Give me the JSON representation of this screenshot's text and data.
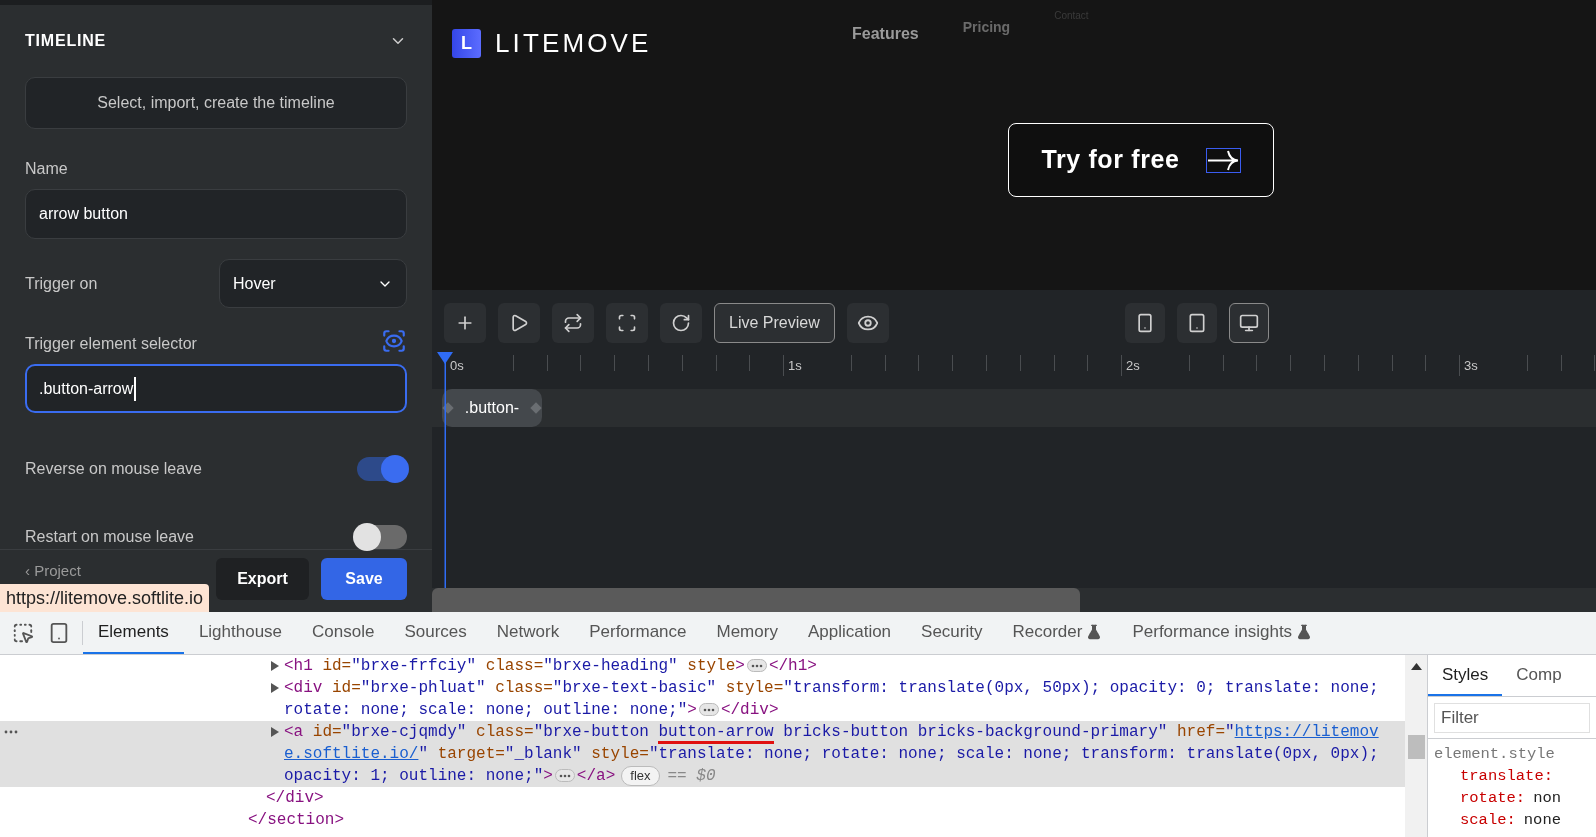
{
  "panel": {
    "title": "TIMELINE",
    "select_button": "Select, import, create the timeline",
    "name_label": "Name",
    "name_value": "arrow button",
    "trigger_label": "Trigger on",
    "trigger_value": "Hover",
    "selector_label": "Trigger element selector",
    "selector_value": ".button-arrow",
    "toggles": [
      {
        "label": "Reverse on mouse leave",
        "on": true
      },
      {
        "label": "Restart on mouse leave",
        "on": false
      }
    ],
    "back_link": "‹ Project",
    "export": "Export",
    "save": "Save"
  },
  "link_tooltip": "https://litemove.softlite.io",
  "preview": {
    "logo_letter": "L",
    "brand": "LITEMOVE",
    "nav": [
      {
        "label": "Features",
        "kind": "main"
      },
      {
        "label": "Pricing",
        "kind": "faded"
      },
      {
        "label": "Contact",
        "kind": "ghost"
      }
    ],
    "cta": "Try for free"
  },
  "timeline": {
    "live_preview": "Live Preview",
    "devices": [
      {
        "selected": false
      },
      {
        "selected": false
      },
      {
        "selected": true
      }
    ],
    "ruler": [
      "0s",
      "1s",
      "2s",
      "3s"
    ],
    "tracks": [
      {
        "label": ".button-"
      }
    ]
  },
  "devtools": {
    "tabs": [
      {
        "label": "Elements",
        "selected": true,
        "experimental": false
      },
      {
        "label": "Lighthouse",
        "selected": false,
        "experimental": false
      },
      {
        "label": "Console",
        "selected": false,
        "experimental": false
      },
      {
        "label": "Sources",
        "selected": false,
        "experimental": false
      },
      {
        "label": "Network",
        "selected": false,
        "experimental": false
      },
      {
        "label": "Performance",
        "selected": false,
        "experimental": false
      },
      {
        "label": "Memory",
        "selected": false,
        "experimental": false
      },
      {
        "label": "Application",
        "selected": false,
        "experimental": false
      },
      {
        "label": "Security",
        "selected": false,
        "experimental": false
      },
      {
        "label": "Recorder",
        "selected": false,
        "experimental": true
      },
      {
        "label": "Performance insights",
        "selected": false,
        "experimental": true
      }
    ],
    "dom": {
      "children": [
        {
          "children": [
            {
              "selected": false,
              "lines": [
                [
                  {
                    "kind": "tag",
                    "text": "<h1"
                  },
                  {
                    "kind": "attr",
                    "text": " id="
                  },
                  {
                    "kind": "value",
                    "text": "\"brxe-frfciy\""
                  },
                  {
                    "kind": "attr",
                    "text": " class="
                  },
                  {
                    "kind": "value",
                    "text": "\"brxe-heading\""
                  },
                  {
                    "kind": "attr",
                    "text": " style"
                  },
                  {
                    "kind": "tag",
                    "text": ">"
                  },
                  {
                    "kind": "dots"
                  },
                  {
                    "kind": "tag",
                    "text": "</h1>"
                  }
                ]
              ]
            },
            {
              "selected": false,
              "lines": [
                [
                  {
                    "kind": "tag",
                    "text": "<div"
                  },
                  {
                    "kind": "attr",
                    "text": " id="
                  },
                  {
                    "kind": "value",
                    "text": "\"brxe-phluat\""
                  },
                  {
                    "kind": "attr",
                    "text": " class="
                  },
                  {
                    "kind": "value",
                    "text": "\"brxe-text-basic\""
                  },
                  {
                    "kind": "attr",
                    "text": " style="
                  },
                  {
                    "kind": "value",
                    "text": "\"transform: translate(0px, 50px); opacity: 0; translate: none;"
                  }
                ],
                [
                  {
                    "kind": "value",
                    "text": "rotate: none; scale: none; outline: none;\""
                  },
                  {
                    "kind": "tag",
                    "text": ">"
                  },
                  {
                    "kind": "dots"
                  },
                  {
                    "kind": "tag",
                    "text": "</div>"
                  }
                ]
              ]
            },
            {
              "selected": true,
              "lines": [
                [
                  {
                    "kind": "tag",
                    "text": "<a"
                  },
                  {
                    "kind": "attr",
                    "text": " id="
                  },
                  {
                    "kind": "value",
                    "text": "\"brxe-cjqmdy\""
                  },
                  {
                    "kind": "attr",
                    "text": " class="
                  },
                  {
                    "kind": "value",
                    "text": "\"brxe-button "
                  },
                  {
                    "kind": "mark",
                    "text": "button-arrow"
                  },
                  {
                    "kind": "value",
                    "text": " bricks-button bricks-background-primary\""
                  },
                  {
                    "kind": "attr",
                    "text": " href="
                  },
                  {
                    "kind": "value",
                    "text": "\""
                  },
                  {
                    "kind": "link",
                    "text": "https://litemov"
                  }
                ],
                [
                  {
                    "kind": "link",
                    "text": "e.softlite.io/"
                  },
                  {
                    "kind": "value",
                    "text": "\""
                  },
                  {
                    "kind": "attr",
                    "text": " target="
                  },
                  {
                    "kind": "value",
                    "text": "\"_blank\""
                  },
                  {
                    "kind": "attr",
                    "text": " style="
                  },
                  {
                    "kind": "value",
                    "text": "\"translate: none; rotate: none; scale: none; transform: translate(0px, 0px);"
                  }
                ],
                [
                  {
                    "kind": "value",
                    "text": "opacity: 1; outline: none;\""
                  },
                  {
                    "kind": "tag",
                    "text": ">"
                  },
                  {
                    "kind": "dots"
                  },
                  {
                    "kind": "tag",
                    "text": "</a>"
                  },
                  {
                    "kind": "pill",
                    "text": "flex"
                  },
                  {
                    "kind": "plain",
                    "text": "== $0"
                  }
                ]
              ]
            }
          ],
          "closing": "</div>"
        }
      ],
      "closing": "</section>"
    },
    "styles": {
      "tabs": [
        {
          "label": "Styles",
          "selected": true
        },
        {
          "label": "Comp",
          "selected": false
        }
      ],
      "filter_placeholder": "Filter",
      "rule": "element.style",
      "props": [
        {
          "name": "translate:"
        },
        {
          "name": "rotate:",
          "value": "non"
        },
        {
          "name": "scale:",
          "value": "none"
        }
      ]
    }
  }
}
